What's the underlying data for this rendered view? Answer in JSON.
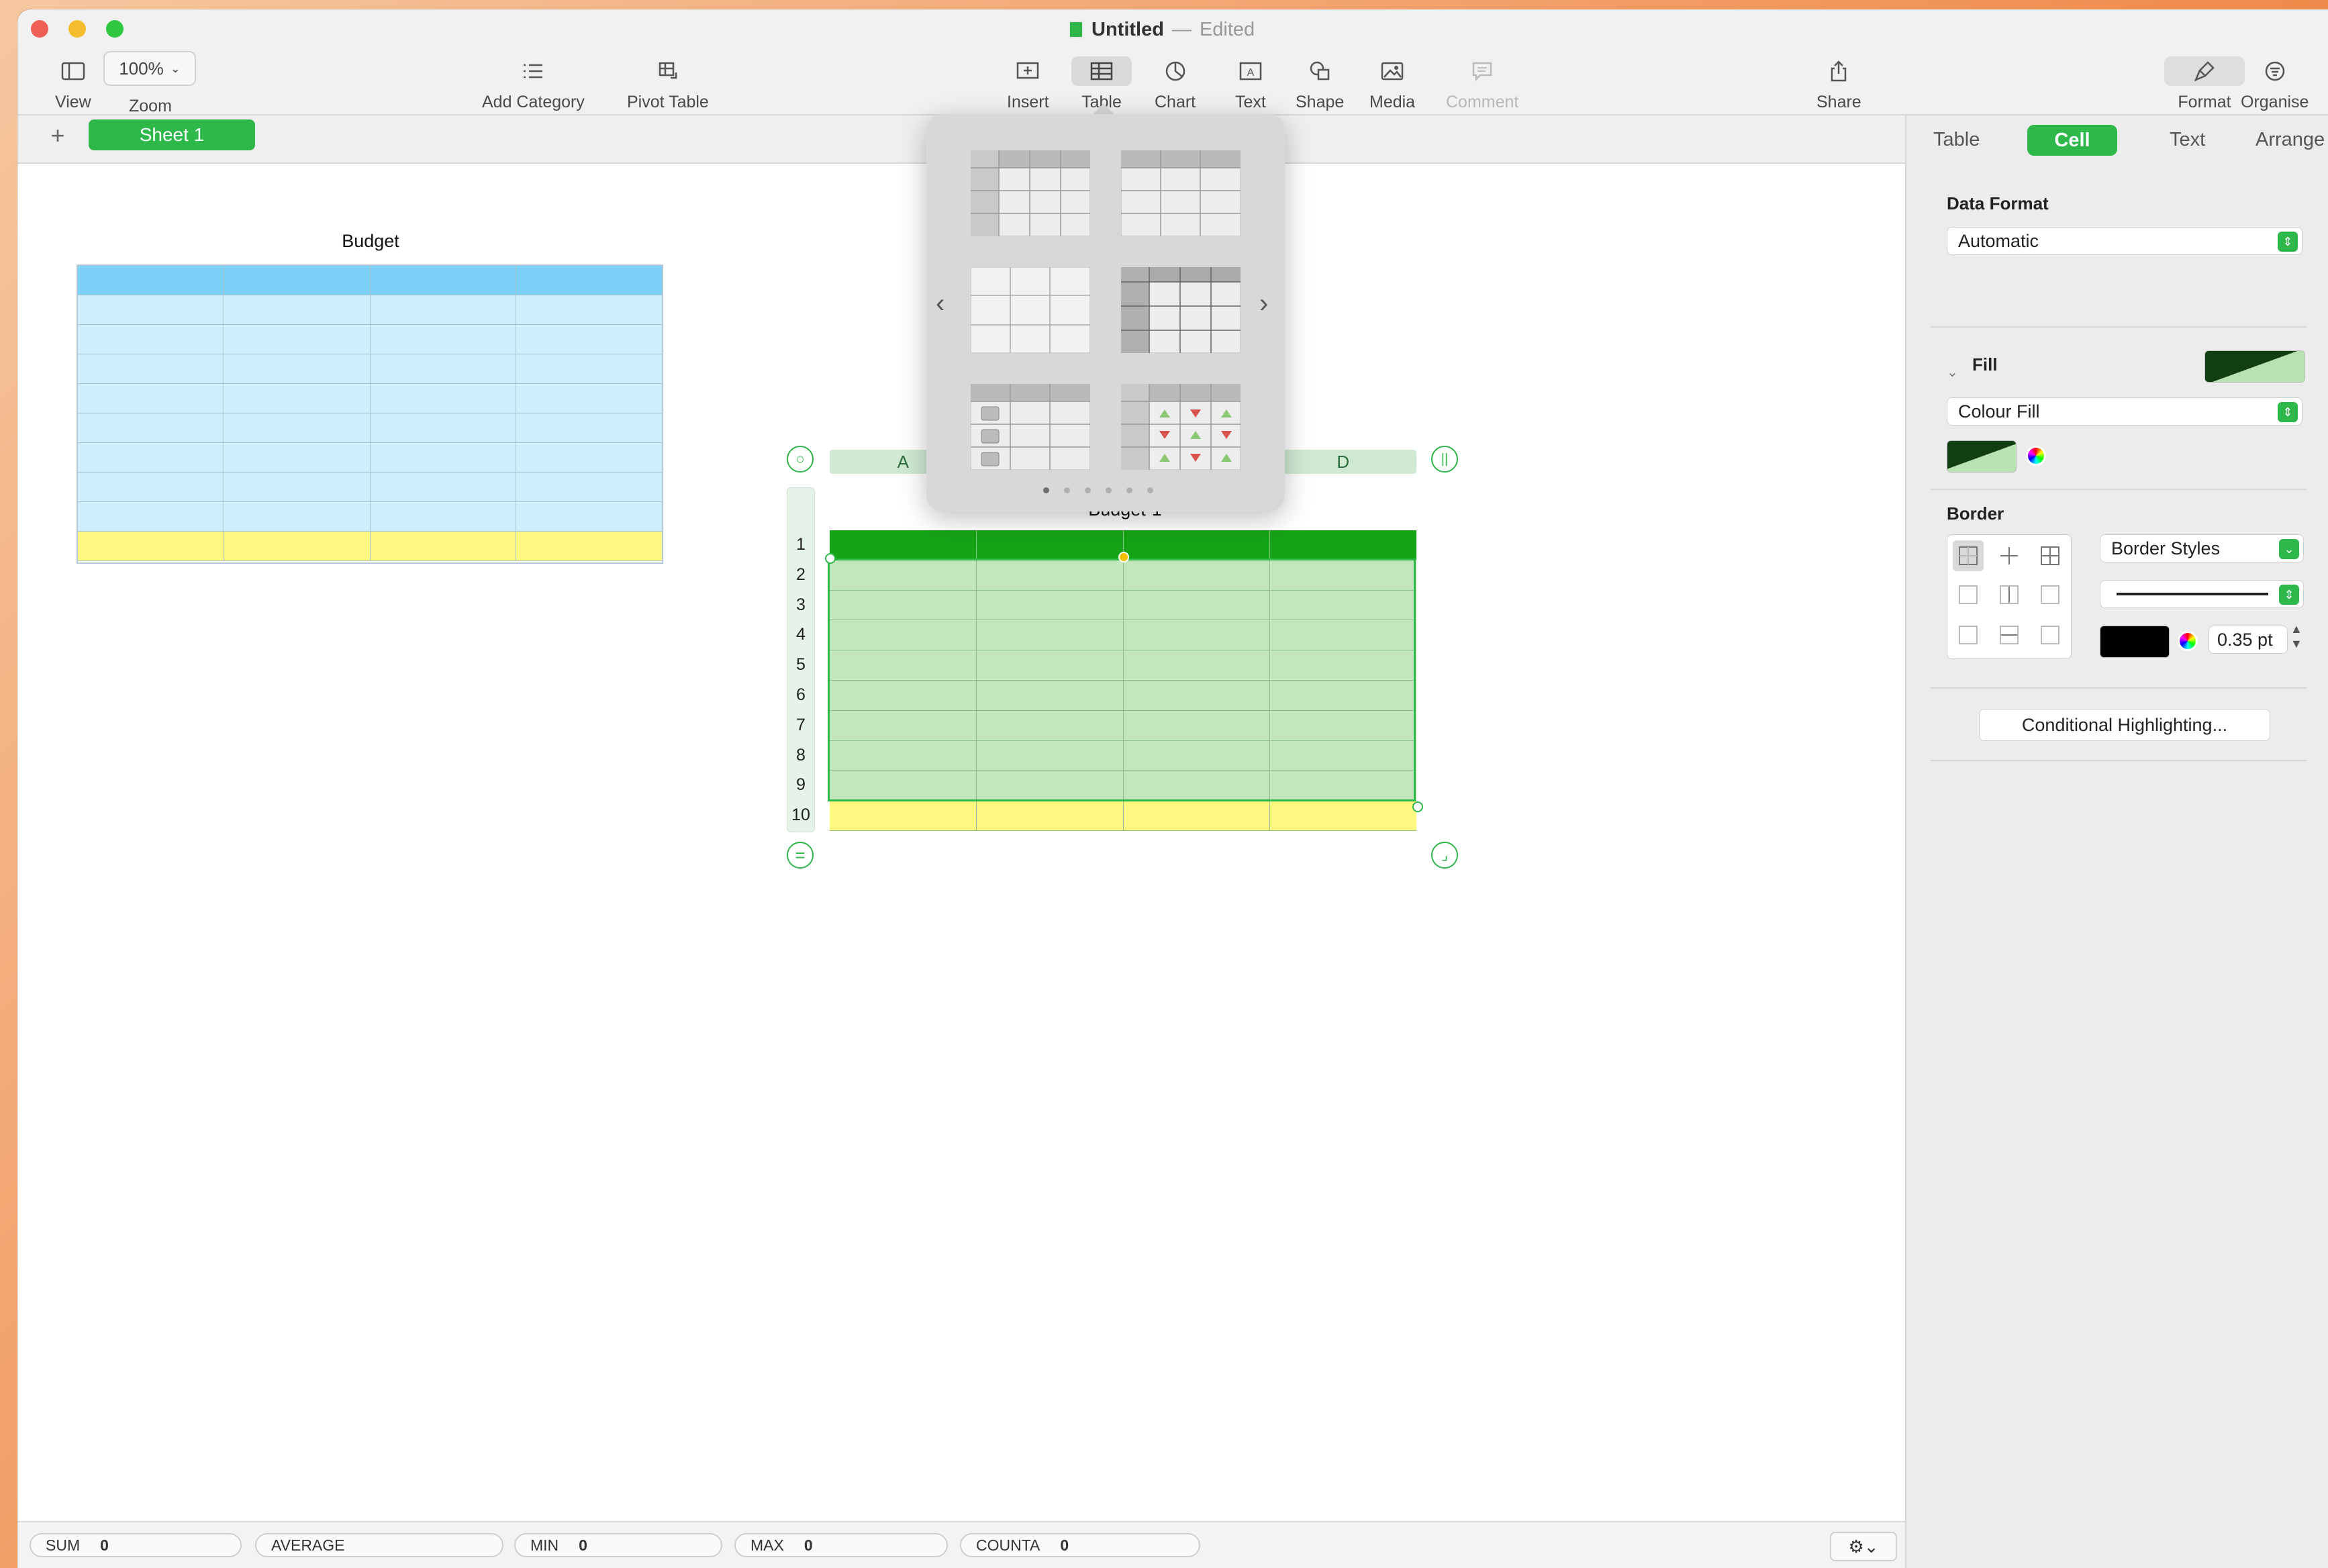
{
  "window": {
    "title": "Untitled",
    "separator": "—",
    "status": "Edited"
  },
  "toolbar": {
    "view": "View",
    "zoom_value": "100%",
    "zoom": "Zoom",
    "add_category": "Add Category",
    "pivot_table": "Pivot Table",
    "insert": "Insert",
    "table": "Table",
    "chart": "Chart",
    "text": "Text",
    "shape": "Shape",
    "media": "Media",
    "comment": "Comment",
    "share": "Share",
    "format": "Format",
    "organise": "Organise"
  },
  "sheets": {
    "add": "+",
    "active": "Sheet 1"
  },
  "canvas": {
    "budget": {
      "title": "Budget"
    },
    "budget1": {
      "title": "Budget-1",
      "columns": [
        "A",
        "",
        "",
        "D"
      ],
      "rows": [
        "1",
        "2",
        "3",
        "4",
        "5",
        "6",
        "7",
        "8",
        "9",
        "10"
      ]
    }
  },
  "inspector": {
    "tabs": [
      "Table",
      "Cell",
      "Text",
      "Arrange"
    ],
    "data_format_label": "Data Format",
    "data_format_value": "Automatic",
    "fill_label": "Fill",
    "fill_type": "Colour Fill",
    "border_label": "Border",
    "border_styles": "Border Styles",
    "border_width": "0.35 pt",
    "conditional": "Conditional Highlighting..."
  },
  "statusbar": [
    {
      "label": "SUM",
      "value": "0"
    },
    {
      "label": "AVERAGE",
      "value": ""
    },
    {
      "label": "MIN",
      "value": "0"
    },
    {
      "label": "MAX",
      "value": "0"
    },
    {
      "label": "COUNTA",
      "value": "0"
    }
  ],
  "colors": {
    "accent": "#2fb84a",
    "budget_header": "#7bd1f7",
    "budget_body": "#cdeefa",
    "budget_footer": "#fcf880",
    "b1_header": "#16a316",
    "b1_body": "#c3e6bd",
    "b1_footer": "#fcf880"
  }
}
